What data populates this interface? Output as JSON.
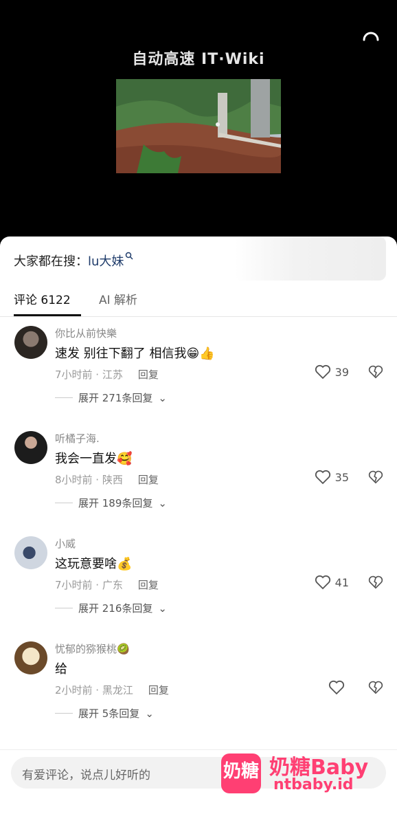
{
  "video": {
    "title": "自动高速 IT·Wiki"
  },
  "search": {
    "prefix": "大家都在搜：",
    "keyword": "lu大妹"
  },
  "tabs": [
    {
      "label": "评论 6122"
    },
    {
      "label": "AI 解析"
    }
  ],
  "comments": [
    {
      "name": "你比从前快樂",
      "text": "速发 别往下翻了 相信我😁👍",
      "meta": "7小时前 · 江苏",
      "reply": "回复",
      "likes": "39",
      "expand": "展开 271条回复"
    },
    {
      "name": "听橘子海.",
      "text": "我会一直发🥰",
      "meta": "8小时前 · 陕西",
      "reply": "回复",
      "likes": "35",
      "expand": "展开 189条回复"
    },
    {
      "name": "小威",
      "text": "这玩意要啥💰",
      "meta": "7小时前 · 广东",
      "reply": "回复",
      "likes": "41",
      "expand": "展开 216条回复"
    },
    {
      "name": "忧郁的猕猴桃🥝",
      "text": "给",
      "meta": "2小时前 · 黑龙江",
      "reply": "回复",
      "likes": "",
      "expand": "展开 5条回复"
    }
  ],
  "input": {
    "placeholder": "有爱评论，说点儿好听的"
  },
  "watermark": {
    "logo": "奶糖",
    "brand": "奶糖Baby",
    "url": "ntbaby.id"
  },
  "colors": {
    "keyword": "#1e3b6a",
    "brand": "#ff3f73"
  }
}
